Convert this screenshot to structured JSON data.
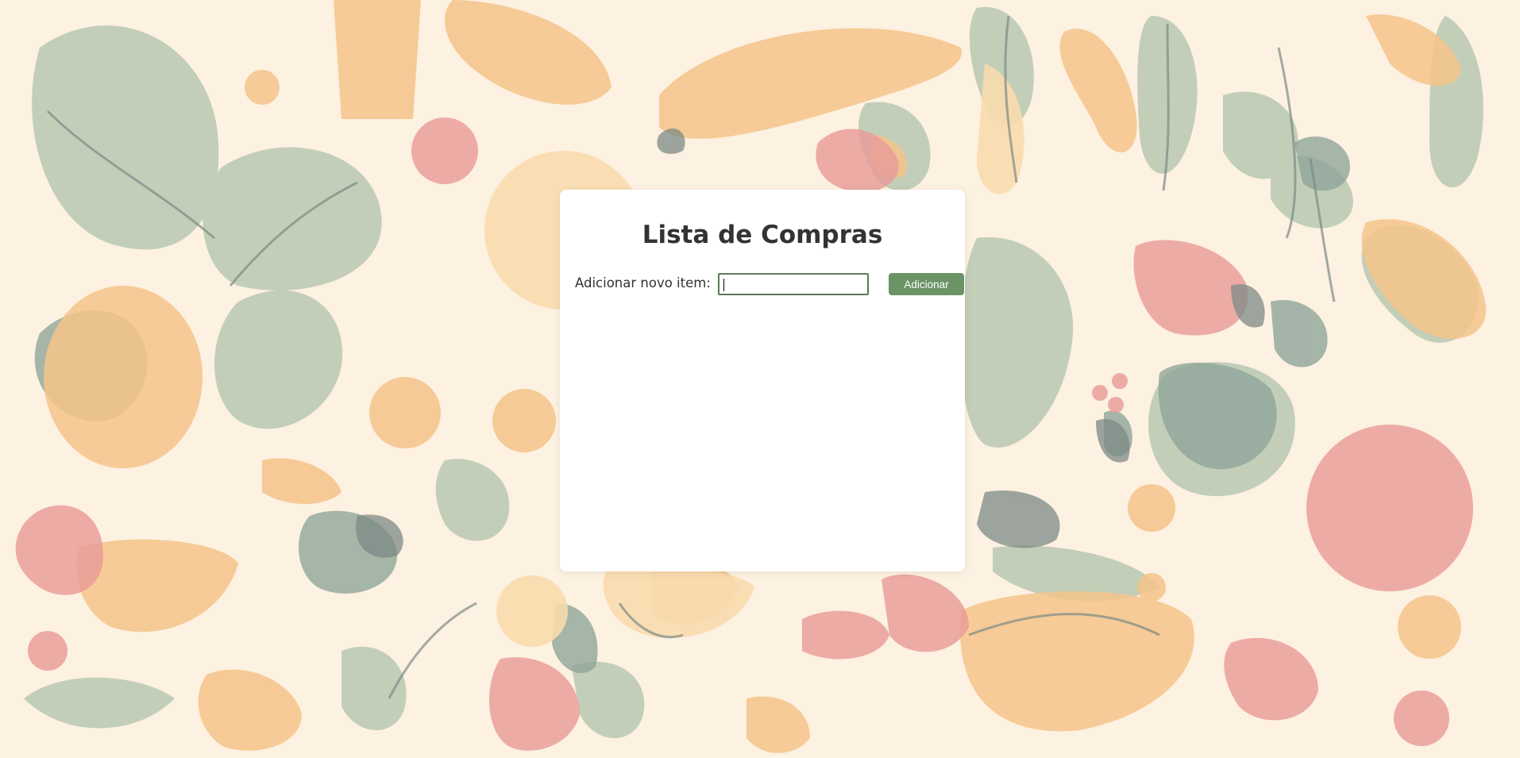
{
  "page": {
    "title": "Lista de Compras"
  },
  "form": {
    "label": "Adicionar novo item:",
    "input_value": "",
    "input_placeholder": "",
    "button_label": "Adicionar"
  },
  "items": [],
  "colors": {
    "background": "#fdf1e1",
    "card": "#ffffff",
    "accent": "#6b9466",
    "input_border": "#5c7a58",
    "text": "#333333"
  },
  "background_art": "food-illustration-pattern"
}
